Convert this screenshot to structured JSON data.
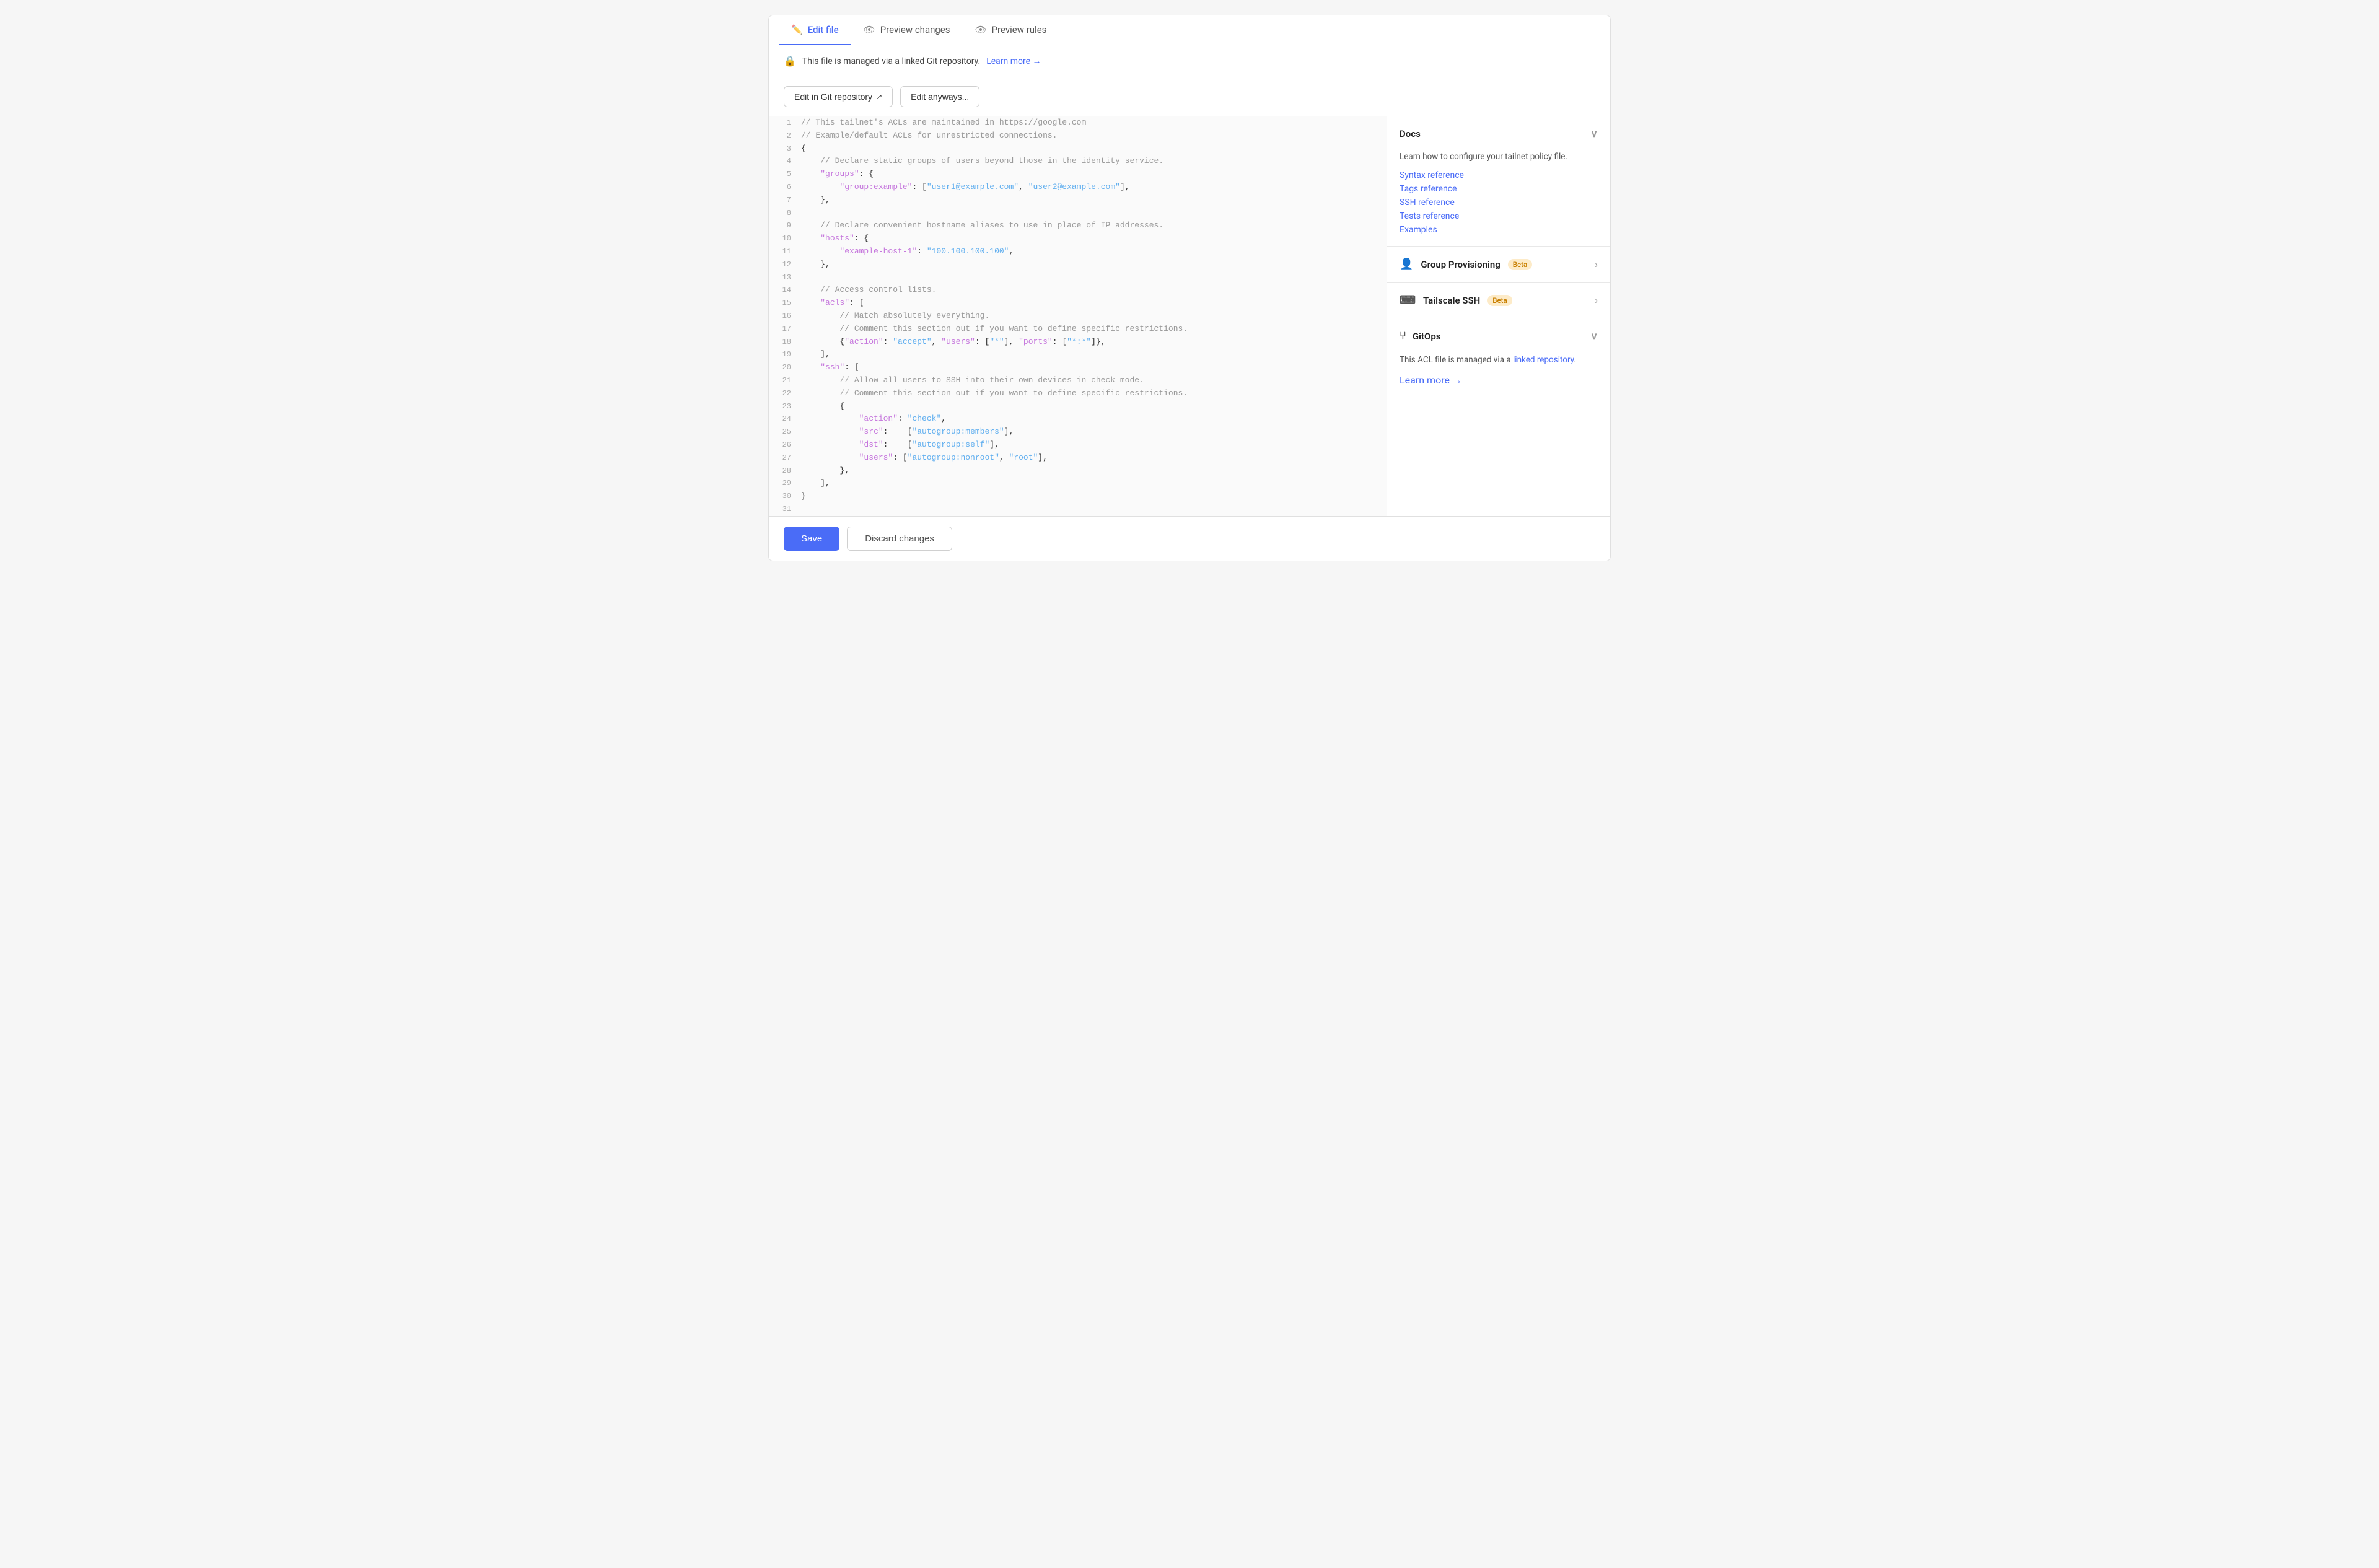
{
  "tabs": [
    {
      "id": "edit-file",
      "label": "Edit file",
      "icon": "✏️",
      "active": true
    },
    {
      "id": "preview-changes",
      "label": "Preview changes",
      "icon": "👁",
      "active": false
    },
    {
      "id": "preview-rules",
      "label": "Preview rules",
      "icon": "👁",
      "active": false
    }
  ],
  "git_notice": {
    "text": "This file is managed via a linked Git repository.",
    "link_label": "Learn more →"
  },
  "buttons": {
    "edit_git": "Edit in Git repository",
    "edit_anyway": "Edit anyways...",
    "save": "Save",
    "discard": "Discard changes"
  },
  "code_lines": [
    {
      "num": 1,
      "text": "// This tailnet's ACLs are maintained in https://google.com",
      "type": "comment"
    },
    {
      "num": 2,
      "text": "// Example/default ACLs for unrestricted connections.",
      "type": "comment"
    },
    {
      "num": 3,
      "text": "{",
      "type": "normal"
    },
    {
      "num": 4,
      "text": "    // Declare static groups of users beyond those in the identity service.",
      "type": "comment"
    },
    {
      "num": 5,
      "text": "    \"groups\": {",
      "type": "key"
    },
    {
      "num": 6,
      "text": "        \"group:example\": [\"user1@example.com\", \"user2@example.com\"],",
      "type": "keystring"
    },
    {
      "num": 7,
      "text": "    },",
      "type": "normal"
    },
    {
      "num": 8,
      "text": "",
      "type": "normal"
    },
    {
      "num": 9,
      "text": "    // Declare convenient hostname aliases to use in place of IP addresses.",
      "type": "comment"
    },
    {
      "num": 10,
      "text": "    \"hosts\": {",
      "type": "key"
    },
    {
      "num": 11,
      "text": "        \"example-host-1\": \"100.100.100.100\",",
      "type": "keystring"
    },
    {
      "num": 12,
      "text": "    },",
      "type": "normal"
    },
    {
      "num": 13,
      "text": "",
      "type": "normal"
    },
    {
      "num": 14,
      "text": "    // Access control lists.",
      "type": "comment"
    },
    {
      "num": 15,
      "text": "    \"acls\": [",
      "type": "key"
    },
    {
      "num": 16,
      "text": "        // Match absolutely everything.",
      "type": "comment"
    },
    {
      "num": 17,
      "text": "        // Comment this section out if you want to define specific restrictions.",
      "type": "comment"
    },
    {
      "num": 18,
      "text": "        {\"action\": \"accept\", \"users\": [\"*\"], \"ports\": [\"*:*\"]},",
      "type": "mixed"
    },
    {
      "num": 19,
      "text": "    ],",
      "type": "normal"
    },
    {
      "num": 20,
      "text": "    \"ssh\": [",
      "type": "key"
    },
    {
      "num": 21,
      "text": "        // Allow all users to SSH into their own devices in check mode.",
      "type": "comment"
    },
    {
      "num": 22,
      "text": "        // Comment this section out if you want to define specific restrictions.",
      "type": "comment"
    },
    {
      "num": 23,
      "text": "        {",
      "type": "normal"
    },
    {
      "num": 24,
      "text": "            \"action\": \"check\",",
      "type": "keystring2"
    },
    {
      "num": 25,
      "text": "            \"src\":    [\"autogroup:members\"],",
      "type": "keystring2"
    },
    {
      "num": 26,
      "text": "            \"dst\":    [\"autogroup:self\"],",
      "type": "keystring2"
    },
    {
      "num": 27,
      "text": "            \"users\": [\"autogroup:nonroot\", \"root\"],",
      "type": "keystring2"
    },
    {
      "num": 28,
      "text": "        },",
      "type": "normal"
    },
    {
      "num": 29,
      "text": "    ],",
      "type": "normal"
    },
    {
      "num": 30,
      "text": "}",
      "type": "normal"
    },
    {
      "num": 31,
      "text": "",
      "type": "normal"
    }
  ],
  "sidebar": {
    "docs_section": {
      "title": "Docs",
      "description": "Learn how to configure your tailnet policy file.",
      "links": [
        {
          "label": "Syntax reference",
          "href": "#"
        },
        {
          "label": "Tags reference",
          "href": "#"
        },
        {
          "label": "SSH reference",
          "href": "#"
        },
        {
          "label": "Tests reference",
          "href": "#"
        },
        {
          "label": "Examples",
          "href": "#"
        }
      ]
    },
    "group_provisioning": {
      "title": "Group Provisioning",
      "badge": "Beta",
      "expanded": false
    },
    "tailscale_ssh": {
      "title": "Tailscale SSH",
      "badge": "Beta",
      "expanded": false
    },
    "gitops": {
      "title": "GitOps",
      "expanded": true,
      "description_prefix": "This ACL file is managed via a ",
      "description_link": "linked repository",
      "description_suffix": ".",
      "learn_more": "Learn more →"
    }
  }
}
